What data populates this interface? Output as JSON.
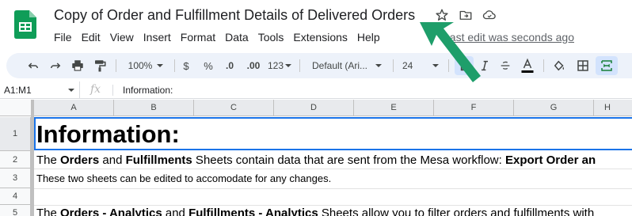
{
  "header": {
    "title": "Copy of Order and Fulfillment Details of Delivered Orders",
    "last_edit": "Last edit was seconds ago",
    "menu": [
      "File",
      "Edit",
      "View",
      "Insert",
      "Format",
      "Data",
      "Tools",
      "Extensions",
      "Help"
    ]
  },
  "toolbar": {
    "zoom": "100%",
    "currency": "$",
    "percent": "%",
    "decrease_decimal": ".0",
    "increase_decimal": ".00",
    "more_formats": "123",
    "font": "Default (Ari...",
    "font_size": "24"
  },
  "formula_bar": {
    "name_box": "A1:M1",
    "fx": "fx",
    "content": "Information:"
  },
  "columns": [
    "A",
    "B",
    "C",
    "D",
    "E",
    "F",
    "G",
    "H"
  ],
  "rows": [
    "1",
    "2",
    "3",
    "4",
    "5"
  ],
  "cells": {
    "a1": "Information:",
    "a2": {
      "p1": "The ",
      "b1": "Orders",
      "p2": " and ",
      "b2": "Fulfillments",
      "p3": " Sheets contain data that are sent from the Mesa workflow: ",
      "b3": "Export Order an"
    },
    "a3": "These two sheets can be edited to accomodate for any changes.",
    "a5": {
      "p1": "The ",
      "b1": "Orders - Analytics",
      "p2": " and ",
      "b2": "Fulfillments - Analytics",
      "p3": " Sheets allow you to filter orders and fulfillments with"
    }
  },
  "colors": {
    "accent": "#1a73e8",
    "arrow": "#1e9e6a",
    "sheets_green": "#0f9d58"
  },
  "icons": [
    "sheets-logo-icon",
    "star-icon",
    "move-folder-icon",
    "cloud-saved-icon",
    "undo-icon",
    "redo-icon",
    "print-icon",
    "paint-format-icon",
    "bold-icon",
    "italic-icon",
    "strikethrough-icon",
    "text-color-icon",
    "fill-color-icon",
    "borders-icon",
    "merge-cells-icon"
  ]
}
